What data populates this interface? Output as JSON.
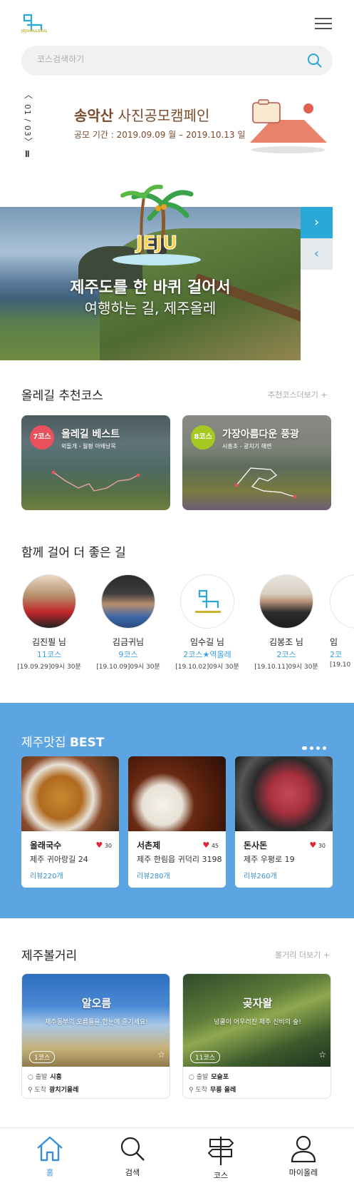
{
  "header": {
    "logo_text": "JEJUOLLEGIL",
    "search_placeholder": "코스검색하기"
  },
  "campaign": {
    "pager": "01 / 03",
    "title_bold": "송악산",
    "title_rest": " 사진공모캠페인",
    "period": "공모 기간 : 2019.09.09 월 – 2019.10.13 일"
  },
  "hero": {
    "badge_text": "JEJU",
    "title": "제주도를 한 바퀴 걸어서",
    "subtitle": "여행하는 길, 제주올레"
  },
  "recommended": {
    "title": "올레길 추천코스",
    "more": "추천코스더보기 +",
    "cards": [
      {
        "num": "7코스",
        "name": "올레길 베스트",
        "route": "외돌개 - 월평 아왜낭목",
        "color": "#e9515d"
      },
      {
        "num": "8코스",
        "name": "가장아름다운 풍광",
        "route": "시흥초 - 광치기 해변",
        "color": "#a5c91f"
      }
    ]
  },
  "walkers": {
    "title": "함께 걸어 더 좋은 길",
    "items": [
      {
        "name": "김진필 님",
        "courses": "11코스",
        "date": "[19.09.29]09시 30분"
      },
      {
        "name": "김금귀님",
        "courses": "9코스",
        "date": "[19.10.09]09시 30분"
      },
      {
        "name": "임수길 님",
        "courses": "2코스★역올레",
        "date": "[19.10.02]09시 30분"
      },
      {
        "name": "김봉조 님",
        "courses": "2코스",
        "date": "[19.10.11]09시 30분"
      },
      {
        "name": "임",
        "courses": "2코",
        "date": "[19.10"
      }
    ]
  },
  "food": {
    "title_plain": "제주맛집 ",
    "title_bold": "BEST",
    "items": [
      {
        "name": "올래국수",
        "likes": "30",
        "addr": "제주 귀아랑길 24",
        "reviews": "리뷰220개"
      },
      {
        "name": "서촌제",
        "likes": "45",
        "addr": "제주 한림읍 귀덕리 3198",
        "reviews": "리뷰280개"
      },
      {
        "name": "돈사돈",
        "likes": "30",
        "addr": "제주 우평로 19",
        "reviews": "리뷰260개"
      }
    ]
  },
  "attractions": {
    "title": "제주볼거리",
    "more": "볼거리 더보기 +",
    "items": [
      {
        "name": "알오름",
        "desc": "제주동부의 오름들을 한눈에 즐기세요!",
        "count": "1코스",
        "start_label": "출발",
        "start": "시흥",
        "end_label": "도착",
        "end": "광치기올레"
      },
      {
        "name": "곶자왈",
        "desc": "넝쿨이 어우러진 제주 신비의 숲!",
        "count": "11코스",
        "start_label": "출발",
        "start": "모슬포",
        "end_label": "도착",
        "end": "무릉 올레"
      }
    ]
  },
  "nav": {
    "home": "홈",
    "search": "검색",
    "course": "코스",
    "my": "마이올레"
  },
  "colors": {
    "accent": "#3a8fd8",
    "hero_button": "#2aa8d8",
    "food_bg": "#5da4e3",
    "heart": "#e0243a"
  }
}
